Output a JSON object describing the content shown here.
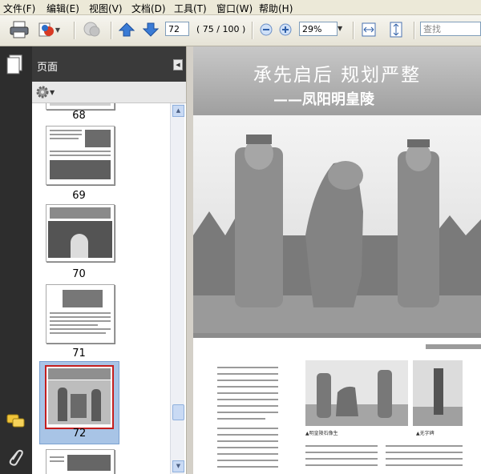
{
  "menu": [
    "文件(F)",
    "编辑(E)",
    "视图(V)",
    "文档(D)",
    "工具(T)",
    "窗口(W)",
    "帮助(H)"
  ],
  "toolbar": {
    "page_number": "72",
    "page_count": "( 75 / 100 )",
    "zoom": "29%",
    "search_placeholder": "查找"
  },
  "panel": {
    "title": "页面",
    "thumbnails": [
      {
        "label": "68"
      },
      {
        "label": "69"
      },
      {
        "label": "70"
      },
      {
        "label": "71"
      },
      {
        "label": "72",
        "selected": true
      }
    ]
  },
  "document": {
    "headline": "承先启后 规划严整",
    "subtitle": "——凤阳明皇陵",
    "caption_left": "▲明皇陵石像生",
    "caption_right": "▲无字碑"
  },
  "colors": {
    "selection": "#a8c4e6",
    "selected_border": "#c41e1e"
  }
}
